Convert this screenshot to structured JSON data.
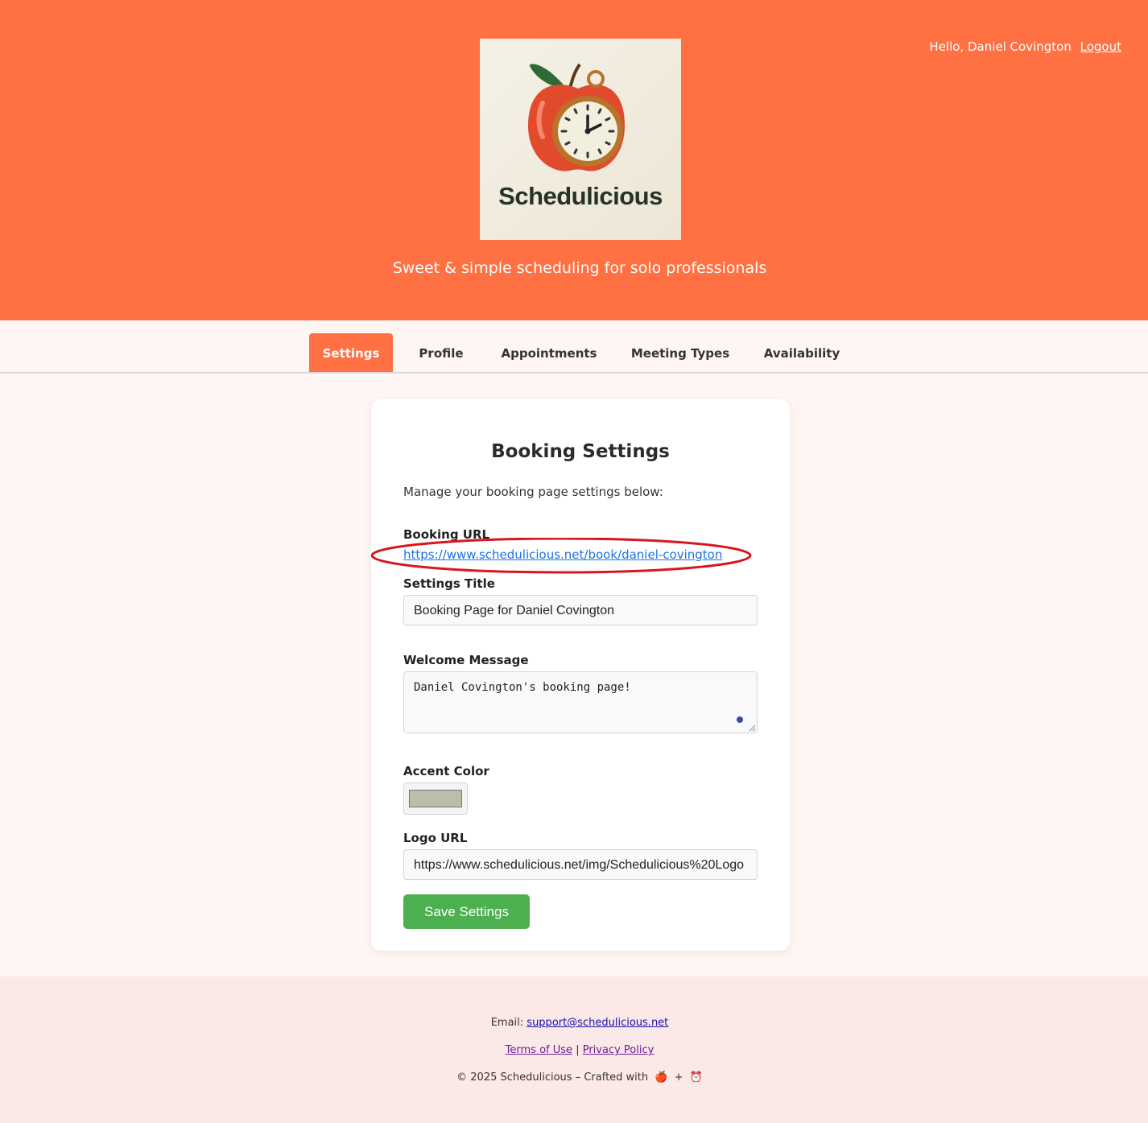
{
  "header": {
    "brand": "Schedulicious",
    "tagline": "Sweet & simple scheduling for solo professionals",
    "greeting": "Hello, Daniel Covington",
    "logout": "Logout",
    "color": "#ff7043"
  },
  "tabs": [
    {
      "label": "Settings",
      "active": true
    },
    {
      "label": "Profile"
    },
    {
      "label": "Appointments"
    },
    {
      "label": "Meeting Types"
    },
    {
      "label": "Availability"
    }
  ],
  "card": {
    "title": "Booking Settings",
    "intro": "Manage your booking page settings below:",
    "booking_url_label": "Booking URL",
    "booking_url": "https://www.schedulicious.net/book/daniel-covington",
    "settings_title_label": "Settings Title",
    "settings_title_value": "Booking Page for Daniel Covington",
    "welcome_label": "Welcome Message",
    "welcome_value": "Daniel Covington's booking page!",
    "accent_label": "Accent Color",
    "accent_value": "#b9bfab",
    "logo_url_label": "Logo URL",
    "logo_url_value": "https://www.schedulicious.net/img/Schedulicious%20Logo",
    "save_label": "Save Settings"
  },
  "footer": {
    "email_prefix": "Email:",
    "email": "support@schedulicious.net",
    "terms": "Terms of Use",
    "separator": "|",
    "privacy": "Privacy Policy",
    "copyright": "© 2025 Schedulicious – Crafted with",
    "plus": "+",
    "apple_icon": "🍎",
    "clock_icon": "⏰"
  }
}
